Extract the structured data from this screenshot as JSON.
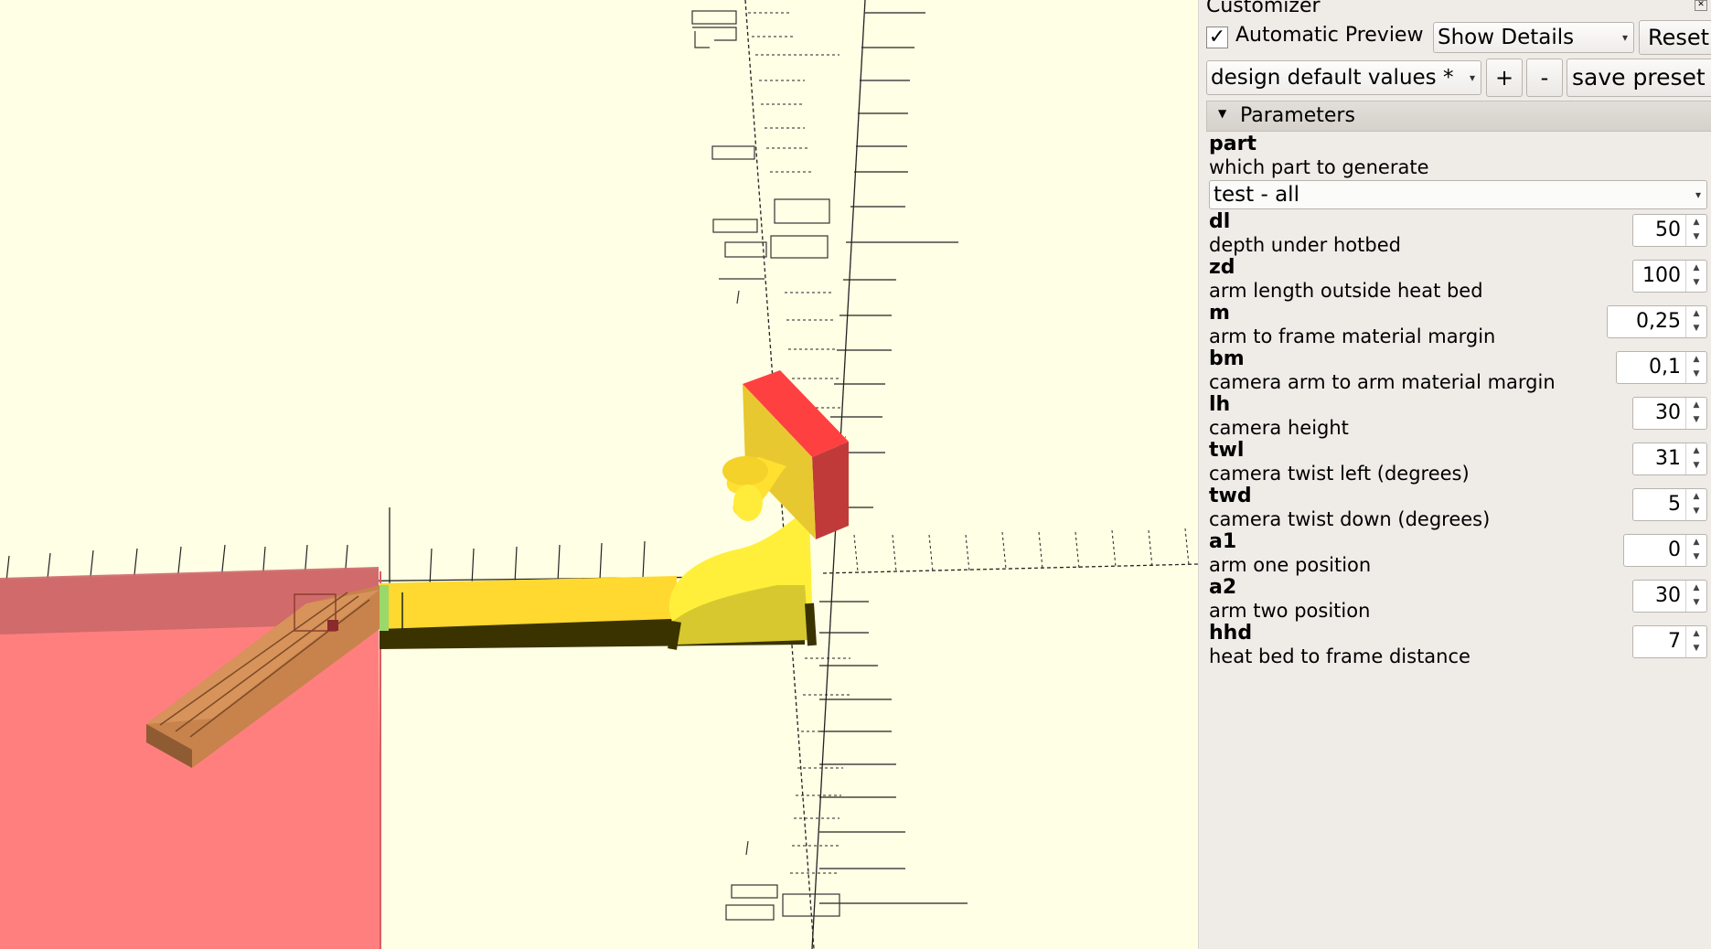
{
  "customizer": {
    "title": "Customizer",
    "close_icon": "close-icon",
    "auto_preview_checked": true,
    "auto_preview_label": "Automatic Preview",
    "details_combo": "Show Details",
    "reset_label": "Reset",
    "preset_combo": "design default values *",
    "add_preset_label": "+",
    "remove_preset_label": "-",
    "save_preset_label": "save preset",
    "group_label": "Parameters",
    "part": {
      "name": "part",
      "description": "which part to generate",
      "value": "test - all"
    },
    "params": [
      {
        "name": "dl",
        "description": "depth under hotbed",
        "value": "50"
      },
      {
        "name": "zd",
        "description": "arm length outside heat bed",
        "value": "100"
      },
      {
        "name": "m",
        "description": "arm to frame material margin",
        "value": "0,25"
      },
      {
        "name": "bm",
        "description": "camera arm to arm material margin",
        "value": "0,1"
      },
      {
        "name": "lh",
        "description": "camera height",
        "value": "30"
      },
      {
        "name": "twl",
        "description": "camera twist left (degrees)",
        "value": "31"
      },
      {
        "name": "twd",
        "description": "camera twist down (degrees)",
        "value": "5"
      },
      {
        "name": "a1",
        "description": "arm one position",
        "value": "0"
      },
      {
        "name": "a2",
        "description": "arm two position",
        "value": "30"
      },
      {
        "name": "hhd",
        "description": "heat bed to frame distance",
        "value": "7"
      }
    ]
  },
  "viewport": {
    "background": "#ffffe5",
    "frame_color": "#ff7f7f",
    "arm_color": "#ffe030",
    "camera_mount_color": "#ff4040",
    "bed_color": "#d7935a"
  }
}
